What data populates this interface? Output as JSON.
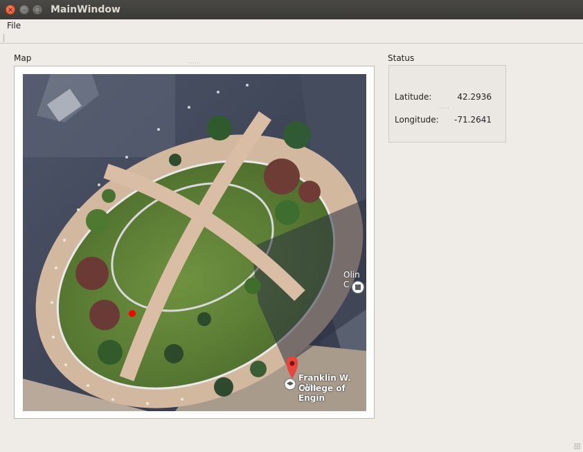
{
  "window": {
    "title": "MainWindow",
    "controls": {
      "close": "×",
      "minimize": "–",
      "maximize": "□"
    }
  },
  "menu": {
    "items": [
      "File"
    ]
  },
  "map": {
    "group_label": "Map",
    "overlay_labels": {
      "building": "Olin C",
      "campus_line1": "Franklin W. Olin",
      "campus_line2": "College of Engin"
    },
    "marker_color": "#ff0000",
    "pin_color": "#e8453c"
  },
  "status": {
    "group_label": "Status",
    "latitude_label": "Latitude:",
    "latitude_value": "42.2936",
    "longitude_label": "Longitude:",
    "longitude_value": "-71.2641"
  }
}
